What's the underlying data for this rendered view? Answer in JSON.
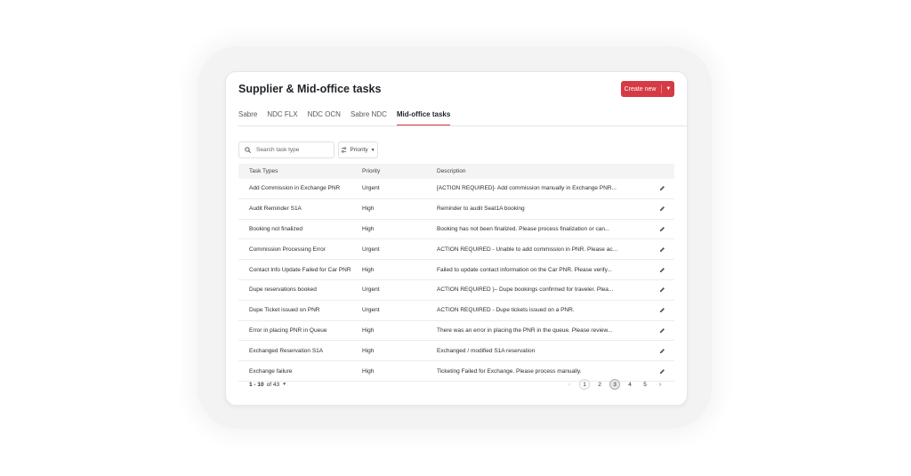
{
  "header": {
    "title": "Supplier & Mid-office tasks",
    "create_label": "Create new"
  },
  "tabs": [
    {
      "label": "Sabre",
      "active": false
    },
    {
      "label": "NDC FLX",
      "active": false
    },
    {
      "label": "NDC OCN",
      "active": false
    },
    {
      "label": "Sabre NDC",
      "active": false
    },
    {
      "label": "Mid-office tasks",
      "active": true
    }
  ],
  "filters": {
    "search_placeholder": "Search task type",
    "priority_label": "Priority"
  },
  "table": {
    "columns": [
      "Task Types",
      "Priority",
      "Description"
    ],
    "rows": [
      {
        "task": "Add Commission in Exchange PNR",
        "priority": "Urgent",
        "description": "[ACTION REQUIRED]- Add commission manually in Exchange PNR..."
      },
      {
        "task": "Audit Reminder S1A",
        "priority": "High",
        "description": "Reminder to audit Seat1A booking"
      },
      {
        "task": "Booking not finalized",
        "priority": "High",
        "description": "Booking has not been finalized. Please process finalization or can..."
      },
      {
        "task": "Commission Processing Error",
        "priority": "Urgent",
        "description": "ACTION REQUIRED - Unable to add commission in PNR. Please ac..."
      },
      {
        "task": "Contact Info Update Failed for Car PNR",
        "priority": "High",
        "description": "Failed to update contact information on the Car PNR. Please verify..."
      },
      {
        "task": "Dupe reservations booked",
        "priority": "Urgent",
        "description": "ACTION REQUIRED )– Dupe bookings confirmed for traveler. Plea..."
      },
      {
        "task": "Dupe Ticket issued on PNR",
        "priority": "Urgent",
        "description": "ACTION REQUIRED - Dupe tickets issued on a PNR."
      },
      {
        "task": "Error in placing PNR in Queue",
        "priority": "High",
        "description": "There was an error in placing the PNR in the queue. Please review..."
      },
      {
        "task": "Exchanged Reservation S1A",
        "priority": "High",
        "description": "Exchanged / modified S1A reservation"
      },
      {
        "task": "Exchange failure",
        "priority": "High",
        "description": "Ticketing Failed for Exchange. Please process manually."
      }
    ]
  },
  "pagination": {
    "range": "1 - 10",
    "of_text": "of 43",
    "pages": [
      "1",
      "2",
      "3",
      "4",
      "5"
    ],
    "current_page": "3",
    "prev_icon": "chevron-left-icon",
    "next_icon": "chevron-right-icon"
  },
  "colors": {
    "accent": "#d63a45",
    "header_bg": "#f4f4f5",
    "border": "#ececee"
  }
}
